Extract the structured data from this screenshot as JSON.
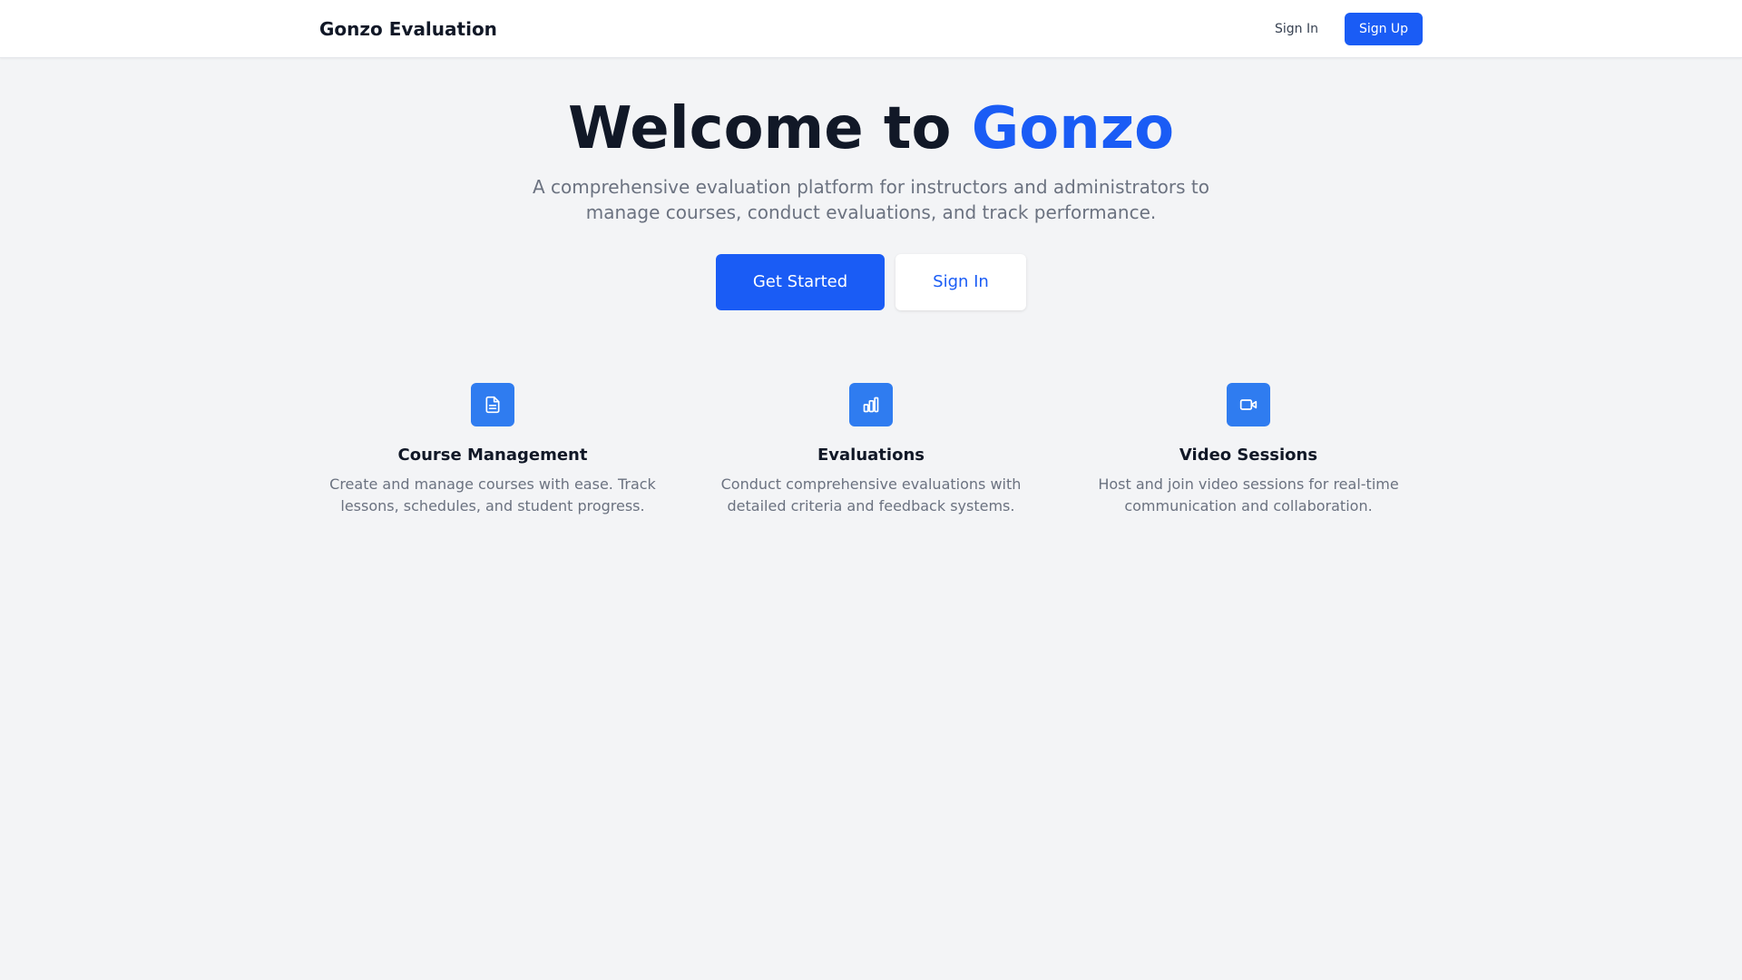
{
  "navbar": {
    "brand": "Gonzo Evaluation",
    "signin_label": "Sign In",
    "signup_label": "Sign Up"
  },
  "hero": {
    "title_prefix": "Welcome to ",
    "title_accent": "Gonzo",
    "subtitle": "A comprehensive evaluation platform for instructors and administrators to manage courses, conduct evaluations, and track performance.",
    "primary_cta": "Get Started",
    "secondary_cta": "Sign In"
  },
  "features": [
    {
      "icon": "document-icon",
      "title": "Course Management",
      "description": "Create and manage courses with ease. Track lessons, schedules, and student progress."
    },
    {
      "icon": "bar-chart-icon",
      "title": "Evaluations",
      "description": "Conduct comprehensive evaluations with detailed criteria and feedback systems."
    },
    {
      "icon": "video-camera-icon",
      "title": "Video Sessions",
      "description": "Host and join video sessions for real-time communication and collaboration."
    }
  ],
  "colors": {
    "accent": "#1a5cf5",
    "icon_bg": "#2f7cf0",
    "background": "#f3f4f6",
    "muted_text": "#6b7280"
  }
}
